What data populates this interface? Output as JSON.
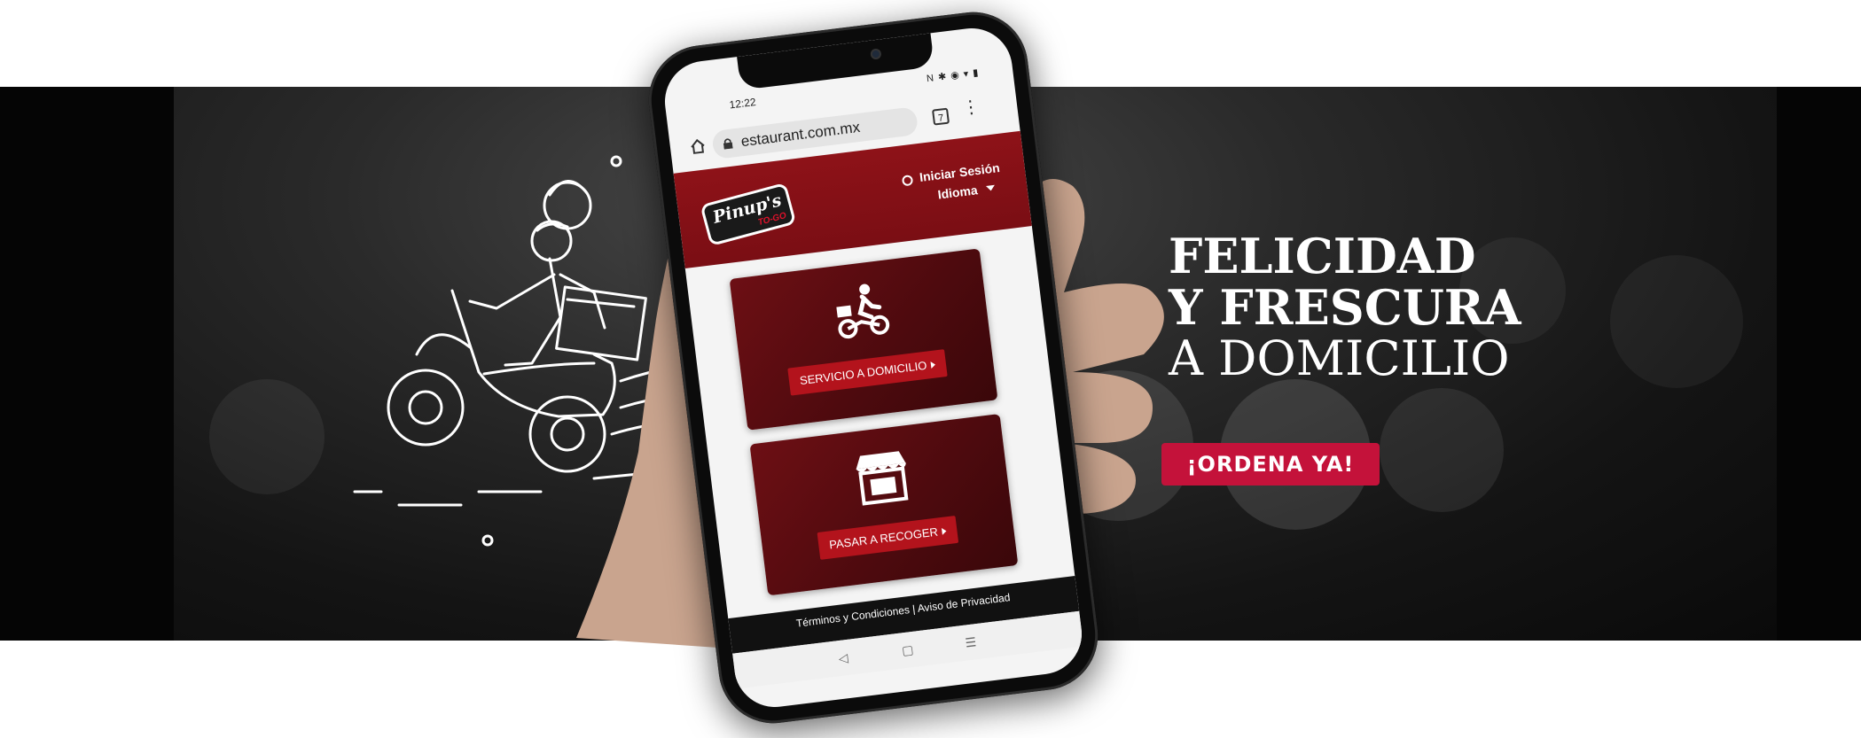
{
  "phone": {
    "status_time": "12:22",
    "status_icons": "N ✱ ◉ ▾ ▮",
    "url_text": "estaurant.com.mx",
    "tab_count": "7",
    "login_label": "Iniciar Sesión",
    "language_label": "Idioma",
    "logo_text": "Pinup's",
    "logo_sub": "TO-GO",
    "cards": [
      {
        "label": "SERVICIO A DOMICILIO",
        "icon": "delivery-scooter-icon"
      },
      {
        "label": "PASAR A RECOGER",
        "icon": "storefront-icon"
      }
    ],
    "footer_links": "Términos y Condiciones | Aviso de Privacidad"
  },
  "hero": {
    "line1": "FELICIDAD",
    "line2": "Y FRESCURA",
    "line3": "A DOMICILIO",
    "cta_label": "¡ORDENA YA!"
  },
  "colors": {
    "brand_red": "#8e1218",
    "cta_red": "#c4123a",
    "band_dark": "#141414"
  }
}
